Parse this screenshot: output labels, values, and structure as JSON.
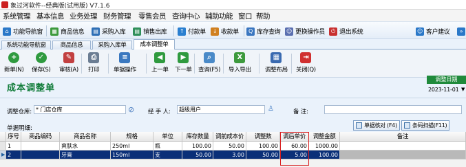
{
  "window": {
    "title": "象过河软件--经典版(试用版) V7.1.6"
  },
  "menu": [
    "系统管理",
    "基本信息",
    "业务处理",
    "财务管理",
    "零售会员",
    "查询中心",
    "辅助功能",
    "窗口",
    "帮助"
  ],
  "quickbar": {
    "items": [
      {
        "label": "功能导航窗",
        "icon": "home-icon",
        "color": "#2a78c8"
      },
      {
        "label": "商品信息",
        "icon": "product-icon",
        "color": "#3d9a3d"
      },
      {
        "label": "采购入库",
        "icon": "purchase-icon",
        "color": "#2f6fb5"
      },
      {
        "label": "销售出库",
        "icon": "sales-icon",
        "color": "#2f8f5a"
      },
      {
        "label": "付款单",
        "icon": "payment-icon",
        "color": "#2a7fd0"
      },
      {
        "label": "收款单",
        "icon": "receipt-icon",
        "color": "#d08020"
      },
      {
        "label": "库存查询",
        "icon": "stock-query-icon",
        "color": "#3a76c0"
      },
      {
        "label": "更换操作员",
        "icon": "switch-user-icon",
        "color": "#5a6fb0"
      },
      {
        "label": "退出系统",
        "icon": "exit-icon",
        "color": "#c83030"
      }
    ],
    "right": {
      "label": "客户建议",
      "icon": "customer-icon"
    }
  },
  "tabs": [
    {
      "label": "系统功能导航窗"
    },
    {
      "label": "商品信息"
    },
    {
      "label": "采购入库单"
    },
    {
      "label": "成本调整单",
      "active": true
    }
  ],
  "toolbar": [
    {
      "label": "新单(N)",
      "icon": "new-icon",
      "color": "#2f9a3f"
    },
    {
      "label": "保存(S)",
      "icon": "save-icon",
      "color": "#2f9a3f"
    },
    {
      "label": "审核(A)",
      "icon": "audit-icon",
      "color": "#c24040"
    },
    {
      "label": "打印",
      "icon": "print-icon",
      "color": "#6b7d93"
    },
    {
      "label": "单据操作",
      "icon": "document-op-icon",
      "color": "#3a78c0"
    },
    {
      "label": "上一单",
      "icon": "prev-icon",
      "color": "#2f9a3f"
    },
    {
      "label": "下一单",
      "icon": "next-icon",
      "color": "#2f9a3f"
    },
    {
      "label": "查询(F5)",
      "icon": "query-icon",
      "color": "#4a8ac8"
    },
    {
      "label": "导入导出",
      "icon": "import-export-icon",
      "color": "#3d9a3d"
    },
    {
      "label": "调整布局",
      "icon": "layout-icon",
      "color": "#3a6ab0"
    },
    {
      "label": "关闭(Q)",
      "icon": "close-icon",
      "color": "#d03030"
    }
  ],
  "page": {
    "title": "成本调整单",
    "date_label": "调整日期",
    "date_value": "2023-11-01"
  },
  "form": {
    "warehouse_label": "调整仓库:",
    "warehouse_value": "* 门店仓库",
    "handler_label": "经 手 人:",
    "handler_value": "超级用户",
    "remark_label": "备    注:",
    "remark_value": ""
  },
  "detail": {
    "label": "单据明细:",
    "check_button": "单据核对 (F4)",
    "scan_button": "条码扫描(F11)"
  },
  "table": {
    "headers": [
      "序号",
      "商品编码",
      "商品名称",
      "规格",
      "单位",
      "库存数量",
      "调前成本价",
      "调整数",
      "调后单价",
      "调整金额",
      "备注"
    ],
    "rows": [
      [
        "1",
        "",
        "爽肤水",
        "250ml",
        "瓶",
        "100.00",
        "50.00",
        "100.00",
        "60.00",
        "1000.00",
        ""
      ],
      [
        "2",
        "",
        "牙膏",
        "150ml",
        "支",
        "50.00",
        "3.00",
        "50.00",
        "5.00",
        "100.00",
        ""
      ]
    ]
  }
}
